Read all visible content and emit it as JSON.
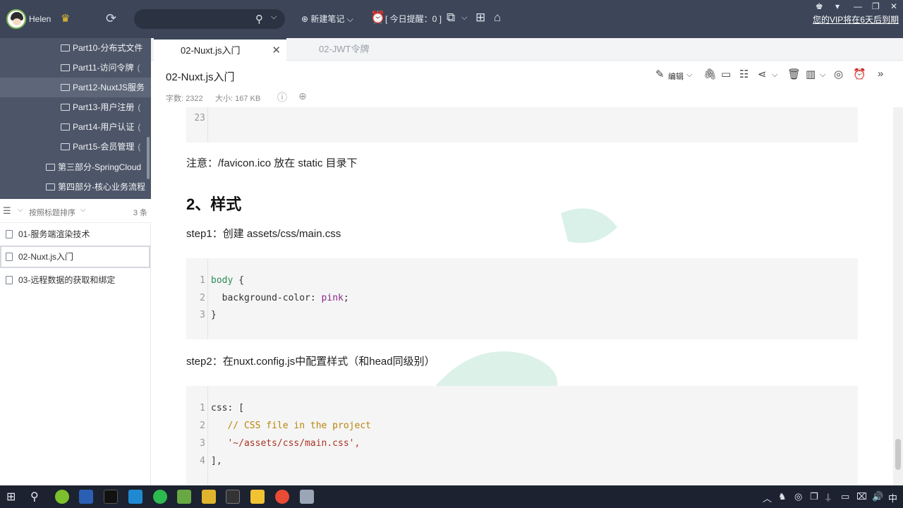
{
  "titlebar": {
    "username": "Helen",
    "search_placeholder": "",
    "new_note": "⊕ 新建笔记 ⌵",
    "reminder": "[ 今日提醒：0 ]",
    "vip_notice": "您的VIP将在6天后到期",
    "icons": [
      "crown-icon",
      "sync-icon",
      "search-icon",
      "clock-icon",
      "screen-icon",
      "grid-icon",
      "home-icon"
    ]
  },
  "sidebar": {
    "tree": [
      {
        "label": "Part10-分布式文件",
        "count": ""
      },
      {
        "label": "Part11-访问令牌",
        "count": "("
      },
      {
        "label": "Part12-NuxtJS服务",
        "count": ""
      },
      {
        "label": "Part13-用户注册",
        "count": "("
      },
      {
        "label": "Part14-用户认证",
        "count": "("
      },
      {
        "label": "Part15-会员管理",
        "count": "("
      },
      {
        "label": "第三部分-SpringCloud",
        "count": ""
      },
      {
        "label": "第四部分-核心业务流程",
        "count": ""
      }
    ],
    "sort_label": "按照标题排序",
    "count": "3 条",
    "notes": [
      {
        "label": "01-服务端渲染技术"
      },
      {
        "label": "02-Nuxt.js入门"
      },
      {
        "label": "03-远程数据的获取和绑定"
      }
    ]
  },
  "tabs": [
    {
      "label": "02-Nuxt.js入门",
      "active": true
    },
    {
      "label": "02-JWT令牌",
      "active": false
    }
  ],
  "note": {
    "title": "02-Nuxt.js入门",
    "edit_label": "编辑",
    "word_count": "字数: 2322",
    "size": "大小: 167 KB"
  },
  "content": {
    "first_line_no": "23",
    "note_favicon": "注意：/favicon.ico 放在 static 目录下",
    "heading": "2、样式",
    "step1": "step1：创建 assets/css/main.css",
    "code1": [
      {
        "n": "1",
        "a": "body",
        "b": " {",
        "c": ""
      },
      {
        "n": "2",
        "a": "",
        "b": "  background-color: ",
        "c": "pink"
      },
      {
        "n": "3",
        "a": "",
        "b": "}",
        "c": ""
      }
    ],
    "code1_semicolon": ";",
    "step2": "step2：在nuxt.config.js中配置样式（和head同级别）",
    "code2": [
      {
        "n": "1",
        "text": "css: ["
      },
      {
        "n": "2",
        "text": "   // CSS file in the project"
      },
      {
        "n": "3",
        "text": "   '~/assets/css/main.css',"
      },
      {
        "n": "4",
        "text": "],"
      }
    ]
  },
  "taskbar": {
    "ime": "中"
  }
}
